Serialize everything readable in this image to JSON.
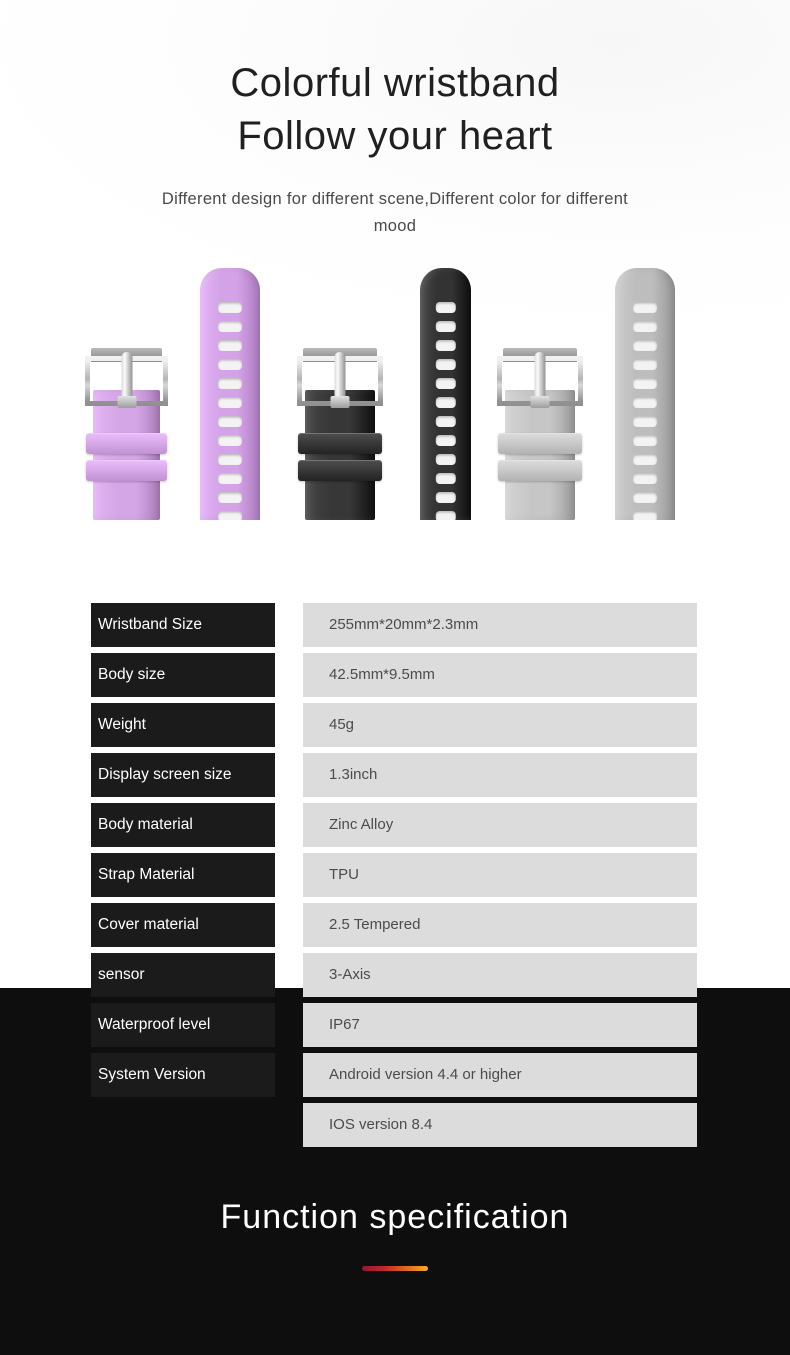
{
  "hero": {
    "title": "Colorful wristband\nFollow your heart",
    "subtitle": "Different design for different scene,Different color for different mood",
    "straps": [
      {
        "name": "purple-buckle-strap",
        "color": "#d5a6e6",
        "style": "buckle"
      },
      {
        "name": "purple-hole-strap",
        "color": "#d4a3e7",
        "style": "holes"
      },
      {
        "name": "black-buckle-strap",
        "color": "#373737",
        "style": "buckle"
      },
      {
        "name": "black-hole-strap",
        "color": "#333333",
        "style": "holes"
      },
      {
        "name": "gray-buckle-strap",
        "color": "#c6c6c6",
        "style": "buckle"
      },
      {
        "name": "gray-hole-strap",
        "color": "#bdbdbd",
        "style": "holes"
      }
    ]
  },
  "spec_table": {
    "rows": [
      {
        "label": "Wristband Size",
        "value": "255mm*20mm*2.3mm"
      },
      {
        "label": "Body size",
        "value": "42.5mm*9.5mm"
      },
      {
        "label": "Weight",
        "value": "45g"
      },
      {
        "label": "Display screen size",
        "value": "1.3inch"
      },
      {
        "label": "Body material",
        "value": "Zinc Alloy"
      },
      {
        "label": "Strap Material",
        "value": "TPU"
      },
      {
        "label": "Cover material",
        "value": "2.5 Tempered"
      },
      {
        "label": "sensor",
        "value": "3-Axis"
      },
      {
        "label": "Waterproof level",
        "value": "IP67"
      },
      {
        "label": "System Version",
        "value": "Android version 4.4 or higher"
      },
      {
        "label": "",
        "value": "IOS version 8.4"
      }
    ]
  },
  "footer": {
    "heading": "Function specification",
    "accent_gradient_from": "#8e1838",
    "accent_gradient_to": "#f5ad22"
  }
}
